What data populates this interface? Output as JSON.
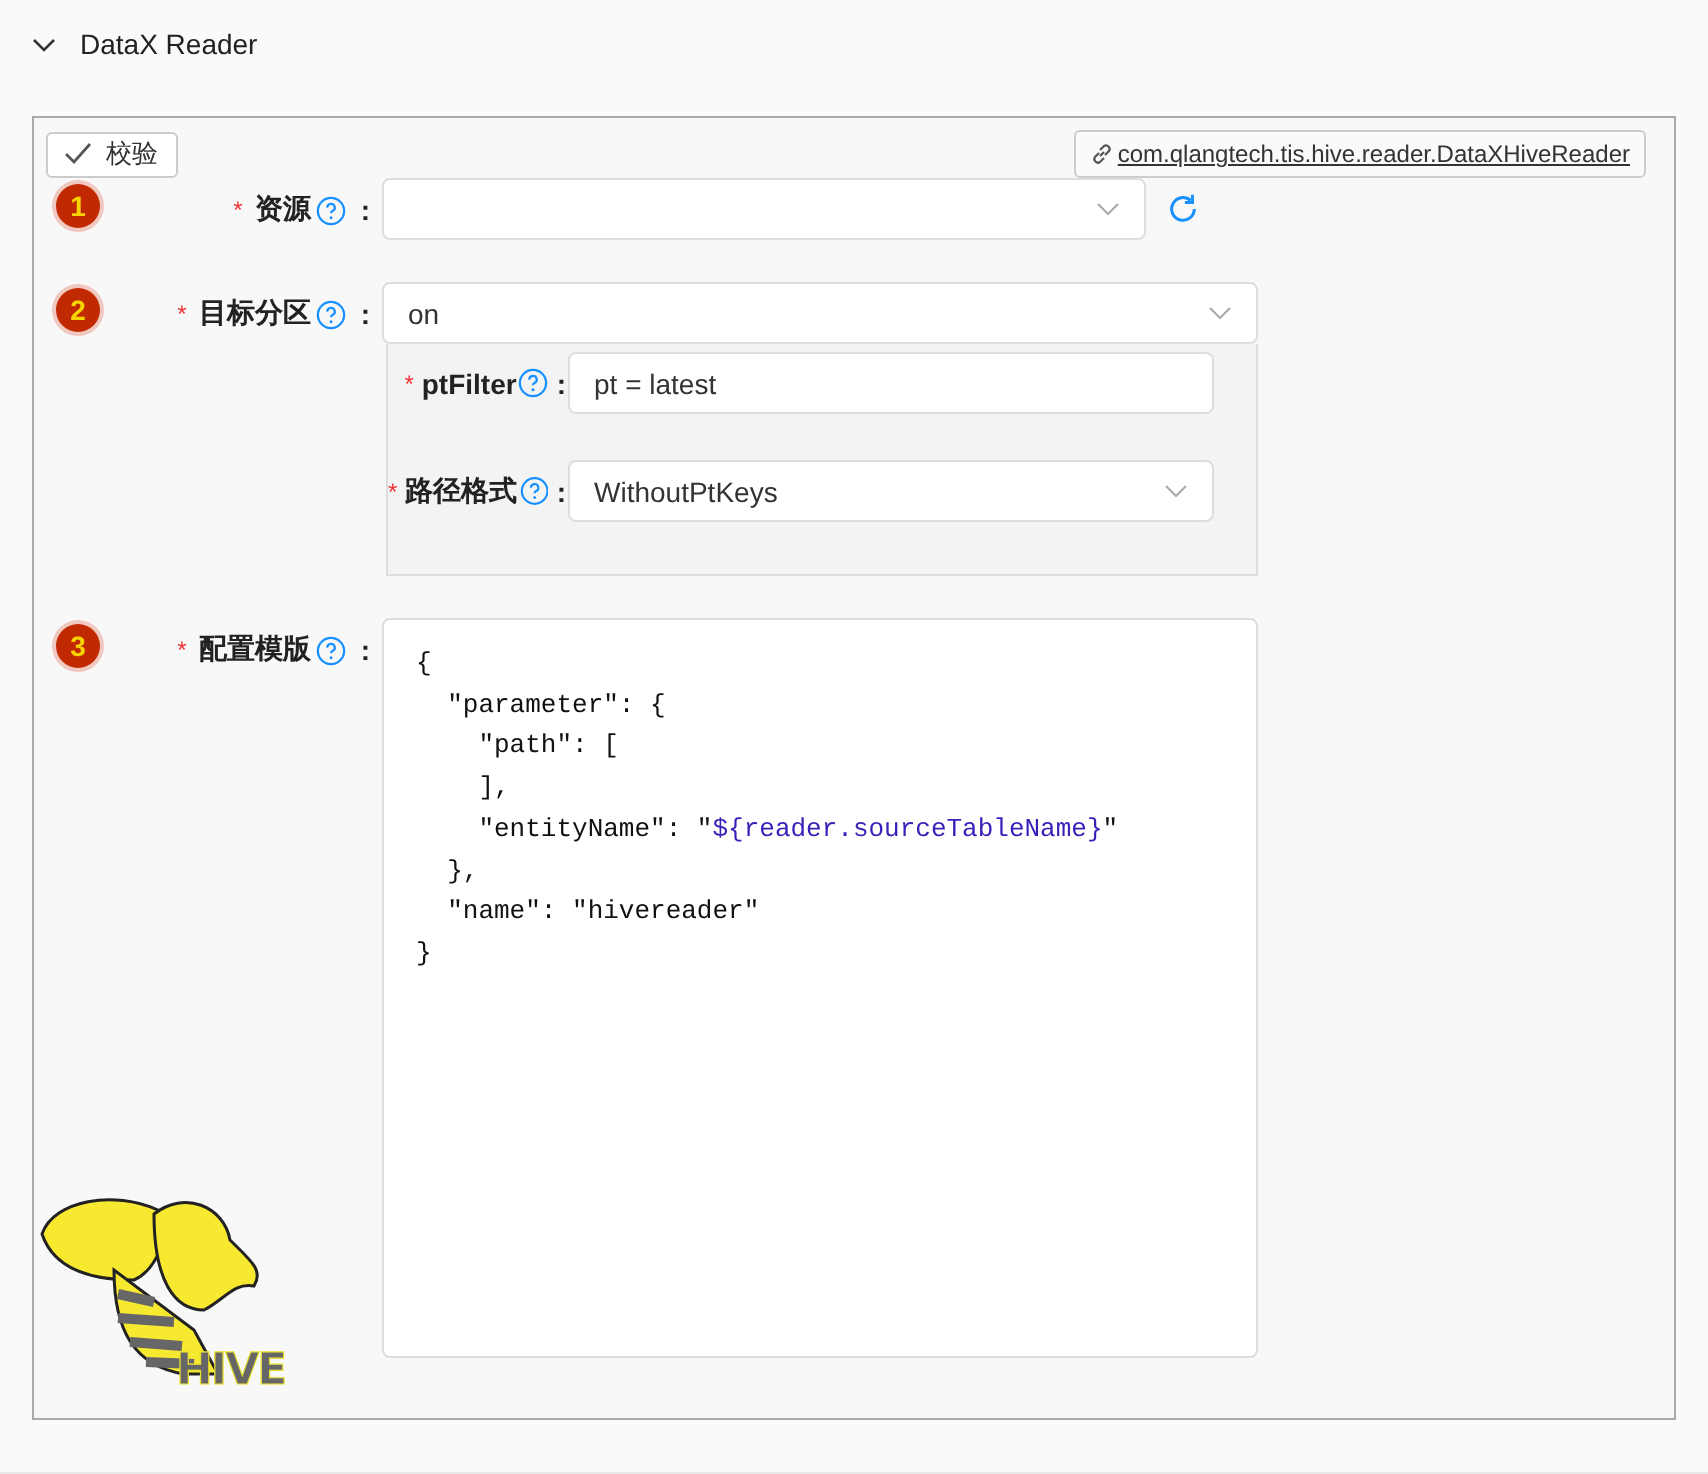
{
  "section": {
    "title": "DataX Reader",
    "expanded": true
  },
  "toolbar": {
    "validate_button": "校验",
    "plugin_link": "com.qlangtech.tis.hive.reader.DataXHiveReader"
  },
  "fields": [
    {
      "step": "1",
      "required_mark": "*",
      "label": "资源",
      "colon": ":",
      "kind": "select",
      "refresh": true
    },
    {
      "step": "2",
      "required_mark": "*",
      "label": "目标分区",
      "colon": ":",
      "kind": "select",
      "value": "on",
      "subfields": [
        {
          "required_mark": "*",
          "label": "ptFilter",
          "colon": ":",
          "kind": "input",
          "value": "pt = latest"
        },
        {
          "required_mark": "*",
          "label": "路径格式",
          "colon": ":",
          "kind": "select",
          "value": "WithoutPtKeys"
        }
      ]
    },
    {
      "step": "3",
      "required_mark": "*",
      "label": "配置模版",
      "colon": ":",
      "kind": "code",
      "lines": [
        [
          {
            "text": "{",
            "kind": "plain"
          }
        ],
        [
          {
            "text": "  \"parameter\": {",
            "kind": "plain"
          }
        ],
        [
          {
            "text": "    \"path\": [",
            "kind": "plain"
          }
        ],
        [
          {
            "text": "    ],",
            "kind": "plain"
          }
        ],
        [
          {
            "text": "    \"entityName\": \"",
            "kind": "plain"
          },
          {
            "text": "${reader.sourceTableName}",
            "kind": "variable"
          },
          {
            "text": "\"",
            "kind": "plain"
          }
        ],
        [
          {
            "text": "  },",
            "kind": "plain"
          }
        ],
        [
          {
            "text": "  \"name\": \"hivereader\"",
            "kind": "plain"
          }
        ],
        [
          {
            "text": "}",
            "kind": "plain"
          }
        ]
      ]
    }
  ],
  "logo": {
    "text": "HIVE"
  }
}
